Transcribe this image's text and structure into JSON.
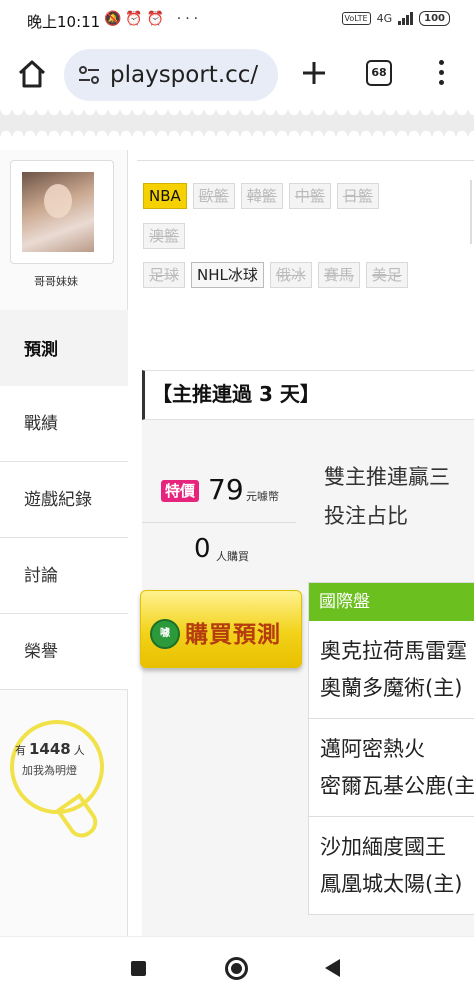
{
  "status_bar": {
    "time": "晚上10:11",
    "icons": "🔕⏰⏰ ···",
    "volte": "VoLTE",
    "network": "4G",
    "battery": "100"
  },
  "browser": {
    "url": "playsport.cc/",
    "tab_count": "68"
  },
  "profile": {
    "name": "哥哥妹妹"
  },
  "sidebar": {
    "items": [
      {
        "label": "預測"
      },
      {
        "label": "戰績"
      },
      {
        "label": "遊戲紀錄"
      },
      {
        "label": "討論"
      },
      {
        "label": "榮譽"
      }
    ]
  },
  "fans": {
    "prefix": "有",
    "count": "1448",
    "suffix": "人",
    "caption": "加我為明燈"
  },
  "categories": {
    "row1": [
      "NBA",
      "歐籃",
      "韓籃",
      "中籃",
      "日籃"
    ],
    "row2": [
      "澳籃"
    ],
    "row3": [
      "足球",
      "NHL冰球",
      "俄冰",
      "賽馬",
      "美足"
    ]
  },
  "section": {
    "heading": "【主推連過 3 天】"
  },
  "offer": {
    "badge": "特價",
    "price": "79",
    "price_unit": "元噱幣",
    "buyers": "0",
    "buyers_unit": "人購買",
    "buy_icon": "噱",
    "buy_label": "購買預測",
    "desc_line1": "雙主推連贏三",
    "desc_line2": "投注占比"
  },
  "games": {
    "header": "國際盤",
    "items": [
      {
        "team1": "奧克拉荷馬雷霆",
        "team2": "奧蘭多魔術(主)"
      },
      {
        "team1": "邁阿密熱火",
        "team2": "密爾瓦基公鹿(主)"
      },
      {
        "team1": "沙加緬度國王",
        "team2": "鳳凰城太陽(主)"
      }
    ]
  },
  "colors": {
    "nba_tag": "#f6d100",
    "badge": "#e6247d",
    "game_header": "#6bbf1e",
    "bulb": "#f2e24a",
    "buy_text": "#b53c0f"
  }
}
